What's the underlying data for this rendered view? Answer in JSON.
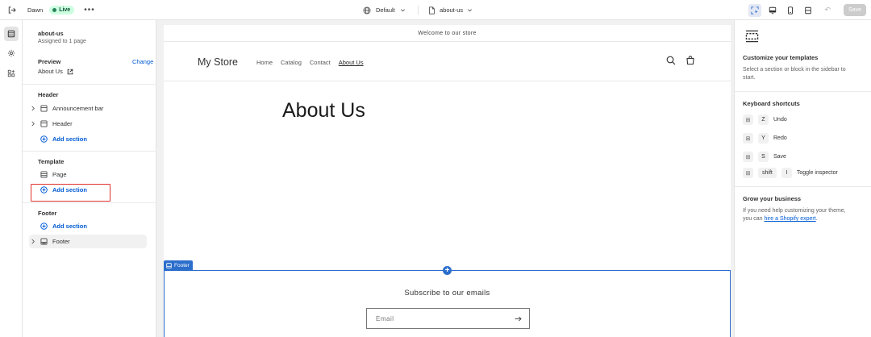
{
  "topbar": {
    "theme_name": "Dawn",
    "status": "Live",
    "more": "•••",
    "template": "Default",
    "page": "about-us",
    "save_label": "Save",
    "colors": {
      "live_bg": "#cdfee1",
      "live_dot": "#29845a",
      "active_icon_bg": "#e3e8f4"
    }
  },
  "sidebar": {
    "page_name": "about-us",
    "assigned": "Assigned to 1 page",
    "preview_label": "Preview",
    "change_label": "Change",
    "preview_page": "About Us",
    "groups": {
      "header": {
        "title": "Header",
        "items": [
          {
            "label": "Announcement bar",
            "icon": "section-icon"
          },
          {
            "label": "Header",
            "icon": "section-icon"
          }
        ],
        "add_label": "Add section"
      },
      "template": {
        "title": "Template",
        "items": [
          {
            "label": "Page",
            "icon": "section-icon"
          }
        ],
        "add_label": "Add section"
      },
      "footer": {
        "title": "Footer",
        "add_label": "Add section",
        "items": [
          {
            "label": "Footer",
            "icon": "footer-section-icon"
          }
        ]
      }
    }
  },
  "preview": {
    "announcement": "Welcome to our store",
    "logo": "My Store",
    "nav": [
      "Home",
      "Catalog",
      "Contact",
      "About Us"
    ],
    "active_nav": "About Us",
    "page_title": "About Us",
    "footer_tag": "Footer",
    "subscribe_title": "Subscribe to our emails",
    "email_placeholder": "Email",
    "colors": {
      "selection": "#2c6ecb"
    }
  },
  "inspector": {
    "customize_title": "Customize your templates",
    "customize_text": "Select a section or block in the sidebar to start.",
    "shortcuts_title": "Keyboard shortcuts",
    "shortcuts": [
      {
        "key": "Z",
        "label": "Undo"
      },
      {
        "key": "Y",
        "label": "Redo"
      },
      {
        "key": "S",
        "label": "Save"
      },
      {
        "key": "shift",
        "key2": "I",
        "label": "Toggle inspector"
      }
    ],
    "grow_title": "Grow your business",
    "grow_text": "If you need help customizing your theme, you can",
    "grow_link": "hire a Shopify expert",
    "grow_end": "."
  }
}
